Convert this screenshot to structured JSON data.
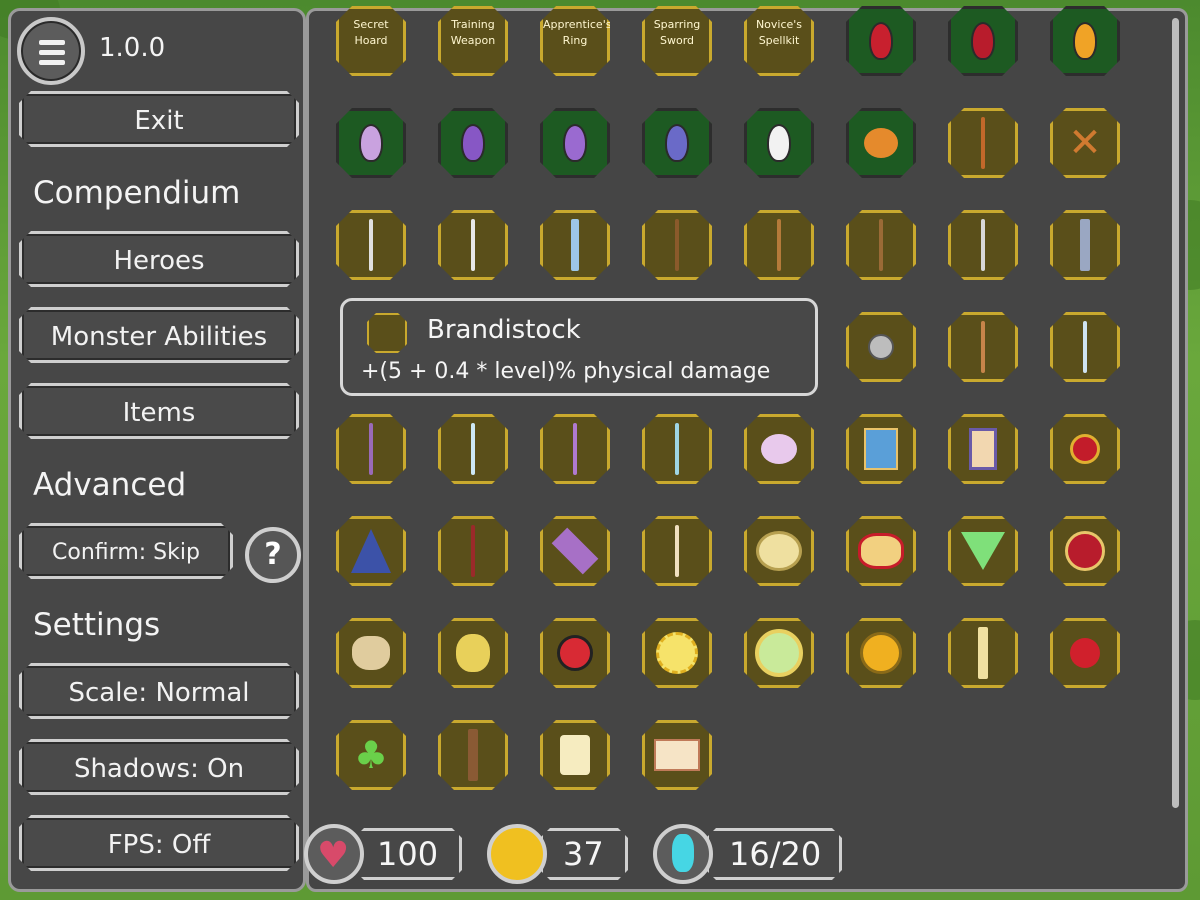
{
  "sidebar": {
    "version": "1.0.0",
    "exit_label": "Exit",
    "compendium_heading": "Compendium",
    "heroes_label": "Heroes",
    "monster_abilities_label": "Monster Abilities",
    "items_label": "Items",
    "advanced_heading": "Advanced",
    "confirm_label": "Confirm: Skip",
    "help_label": "?",
    "settings_heading": "Settings",
    "scale_label": "Scale: Normal",
    "shadows_label": "Shadows: On",
    "fps_label": "FPS: Off"
  },
  "items": {
    "labeled": [
      "Secret Hoard",
      "Training Weapon",
      "Apprentice's Ring",
      "Sparring Sword",
      "Novice's Spellkit"
    ],
    "icons": [
      "red-potion-icon",
      "red-potion-icon",
      "yellow-potion-icon",
      "pink-potion-icon",
      "purple-potion-icon",
      "purple-potion-icon",
      "blue-potion-icon",
      "white-potion-icon",
      "drumstick-icon",
      "sword-icon",
      "crossed-swords-icon",
      "scimitar-icon",
      "sword-icon",
      "broadsword-icon",
      "spear-icon",
      "trident-icon",
      "spear-icon",
      "spear-icon",
      "dagger-icon",
      "brandistock-icon",
      "flail-icon",
      "scepter-icon",
      "spear-icon",
      "staff-icon",
      "staff-icon",
      "staff-icon",
      "feather-staff-icon",
      "orb-icon",
      "book-icon",
      "lantern-icon",
      "amulet-icon",
      "wizard-hat-icon",
      "wand-icon",
      "crystal-icon",
      "staff-icon",
      "ring-icon",
      "ring-icon",
      "gem-icon",
      "ring-icon",
      "loot-bag-icon",
      "mask-icon",
      "ladybug-icon",
      "sun-icon",
      "green-ring-icon",
      "gold-orb-icon",
      "horn-icon",
      "charm-icon",
      "clover-icon",
      "feather-icon",
      "scroll-icon",
      "map-icon"
    ]
  },
  "tooltip": {
    "name": "Brandistock",
    "description": "+(5 + 0.4 * level)% physical damage"
  },
  "stats": {
    "health": "100",
    "gold": "37",
    "population": "16/20"
  },
  "colors": {
    "panel": "#474747",
    "slot_gold": "#c9a92e",
    "slot_green": "#1d5a22"
  }
}
